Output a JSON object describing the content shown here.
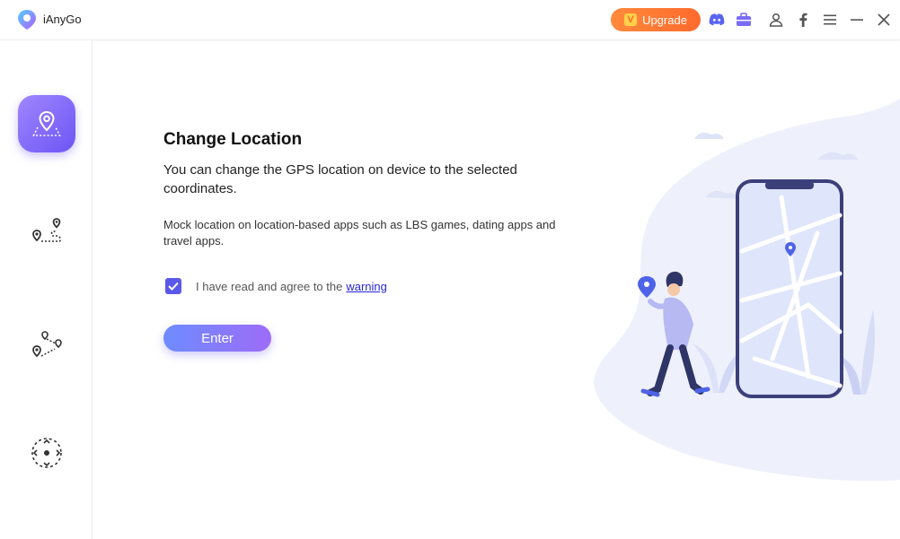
{
  "app": {
    "name": "iAnyGo",
    "upgrade_label": "Upgrade"
  },
  "titlebar_icons": [
    "discord-icon",
    "toolbox-icon",
    "user-icon",
    "facebook-icon",
    "menu-icon",
    "minimize-icon",
    "close-icon"
  ],
  "sidebar": {
    "items": [
      {
        "name": "change-location",
        "icon": "map-pin-area-icon",
        "active": true
      },
      {
        "name": "two-spot-movement",
        "icon": "two-spot-route-icon",
        "active": false
      },
      {
        "name": "multi-spot-movement",
        "icon": "multi-spot-route-icon",
        "active": false
      },
      {
        "name": "joystick-movement",
        "icon": "joystick-icon",
        "active": false
      }
    ]
  },
  "main": {
    "title": "Change Location",
    "description": "You can change the GPS location on device to the selected coordinates.",
    "note": "Mock location on location-based apps such as LBS games, dating apps and travel apps.",
    "agree_text": "I have read and agree to the",
    "warning_link": "warning",
    "agree_checked": true,
    "enter_label": "Enter"
  },
  "colors": {
    "accent": "#6d55f5",
    "upgrade": "#ff7a30",
    "link": "#2727d9"
  }
}
